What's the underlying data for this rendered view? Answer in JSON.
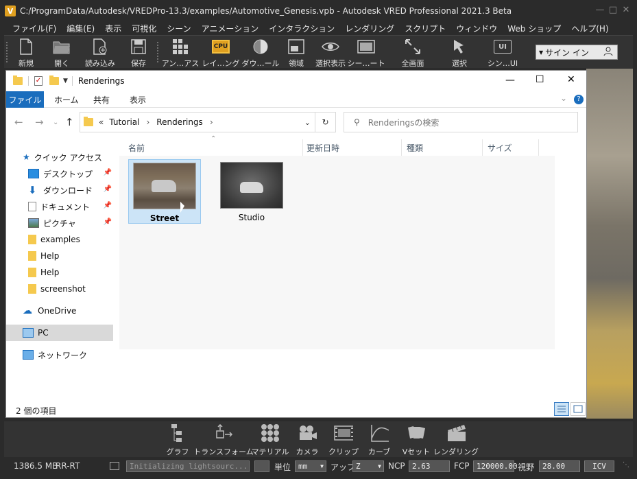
{
  "app": {
    "title": "C:/ProgramData/Autodesk/VREDPro-13.3/examples/Automotive_Genesis.vpb - Autodesk VRED Professional 2021.3 Beta",
    "logo": "V"
  },
  "menu": [
    "ファイル(F)",
    "編集(E)",
    "表示",
    "可視化",
    "シーン",
    "アニメーション",
    "インタラクション",
    "レンダリング",
    "スクリプト",
    "ウィンドウ",
    "Web ショップ",
    "ヘルプ(H)"
  ],
  "toolbar": {
    "items": [
      {
        "label": "新規",
        "icon": "new-file-icon"
      },
      {
        "label": "開く",
        "icon": "open-folder-icon"
      },
      {
        "label": "読み込み",
        "icon": "import-icon"
      },
      {
        "label": "保存",
        "icon": "save-icon"
      },
      {
        "label": "アン…アス",
        "icon": "antialias-icon"
      },
      {
        "label": "レイ…ング",
        "icon": "cpu-icon",
        "badge": "CPU"
      },
      {
        "label": "ダウ…ール",
        "icon": "downscale-icon"
      },
      {
        "label": "領域",
        "icon": "region-icon"
      },
      {
        "label": "選択表示",
        "icon": "eye-icon"
      },
      {
        "label": "シー…ート",
        "icon": "scene-plate-icon"
      },
      {
        "label": "全画面",
        "icon": "fullscreen-icon"
      },
      {
        "label": "選択",
        "icon": "select-icon"
      },
      {
        "label": "シン…UI",
        "icon": "simple-ui-icon",
        "badge": "UI"
      }
    ],
    "signin": "サイン イン"
  },
  "explorer": {
    "title": "Renderings",
    "ribbon": {
      "file": "ファイル",
      "tabs": [
        "ホーム",
        "共有",
        "表示"
      ]
    },
    "address": {
      "prefix": "«",
      "parts": [
        "Tutorial",
        "Renderings"
      ]
    },
    "search_placeholder": "Renderingsの検索",
    "nav": {
      "quick_access": "クイック アクセス",
      "items": [
        {
          "label": "デスクトップ",
          "icon": "desktop-icon",
          "pinned": true
        },
        {
          "label": "ダウンロード",
          "icon": "download-icon",
          "pinned": true
        },
        {
          "label": "ドキュメント",
          "icon": "document-icon",
          "pinned": true
        },
        {
          "label": "ピクチャ",
          "icon": "pictures-icon",
          "pinned": true
        },
        {
          "label": "examples",
          "icon": "folder-icon",
          "pinned": false
        },
        {
          "label": "Help",
          "icon": "folder-icon",
          "pinned": false
        },
        {
          "label": "Help",
          "icon": "folder-icon",
          "pinned": false
        },
        {
          "label": "screenshot",
          "icon": "folder-icon",
          "pinned": false
        }
      ],
      "onedrive": "OneDrive",
      "pc": "PC",
      "network": "ネットワーク"
    },
    "columns": [
      "名前",
      "更新日時",
      "種類",
      "サイズ"
    ],
    "files": [
      {
        "name": "Street",
        "selected": true
      },
      {
        "name": "Studio",
        "selected": false
      }
    ],
    "status": "2 個の項目"
  },
  "bottom_toolbar": [
    {
      "label": "グラフ",
      "icon": "graph-icon"
    },
    {
      "label": "トランスフォーム",
      "icon": "transform-icon"
    },
    {
      "label": "マテリアル",
      "icon": "material-icon"
    },
    {
      "label": "カメラ",
      "icon": "camera-icon"
    },
    {
      "label": "クリップ",
      "icon": "clip-icon"
    },
    {
      "label": "カーブ",
      "icon": "curve-icon"
    },
    {
      "label": "Vセット",
      "icon": "vset-icon"
    },
    {
      "label": "レンダリング",
      "icon": "render-icon"
    }
  ],
  "statusbar": {
    "memory": "1386.5 MB",
    "mode": "RR-RT",
    "message": "Initializing lightsourc...",
    "unit_label": "単位",
    "unit": "mm",
    "up_label": "アップ",
    "up": "Z",
    "ncp_label": "NCP",
    "ncp": "2.63",
    "fcp_label": "FCP",
    "fcp": "120000.00",
    "fov_label": "視野",
    "fov": "28.00",
    "icv": "ICV"
  }
}
